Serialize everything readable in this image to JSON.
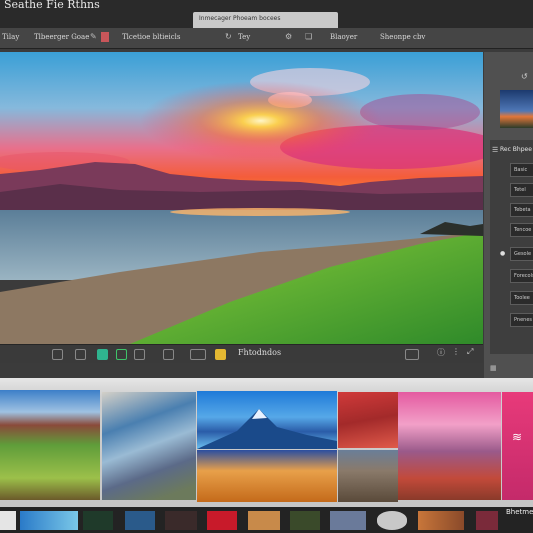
{
  "app": {
    "title": "Seathe Fie Rthns"
  },
  "tab": {
    "label": "Inmecager Phoeam bocees"
  },
  "menu": [
    "Tilay",
    "Tlbeerger Goae",
    "Tlcetioe bltieicls",
    "Tey",
    "Blaoyer",
    "Sheonpe cbv"
  ],
  "editor": {
    "filename": "Fhtodndos"
  },
  "panel": {
    "header": "Rec Bhpee",
    "items": [
      "Basic",
      "Tetel",
      "Tebeta",
      "Tencoe",
      "Gesole",
      "Forecols",
      "Toolee",
      "Pnenes"
    ]
  },
  "filmstrip": {
    "label": "Bhetmeer"
  },
  "colors": {
    "accent": "#2f9ed8"
  }
}
